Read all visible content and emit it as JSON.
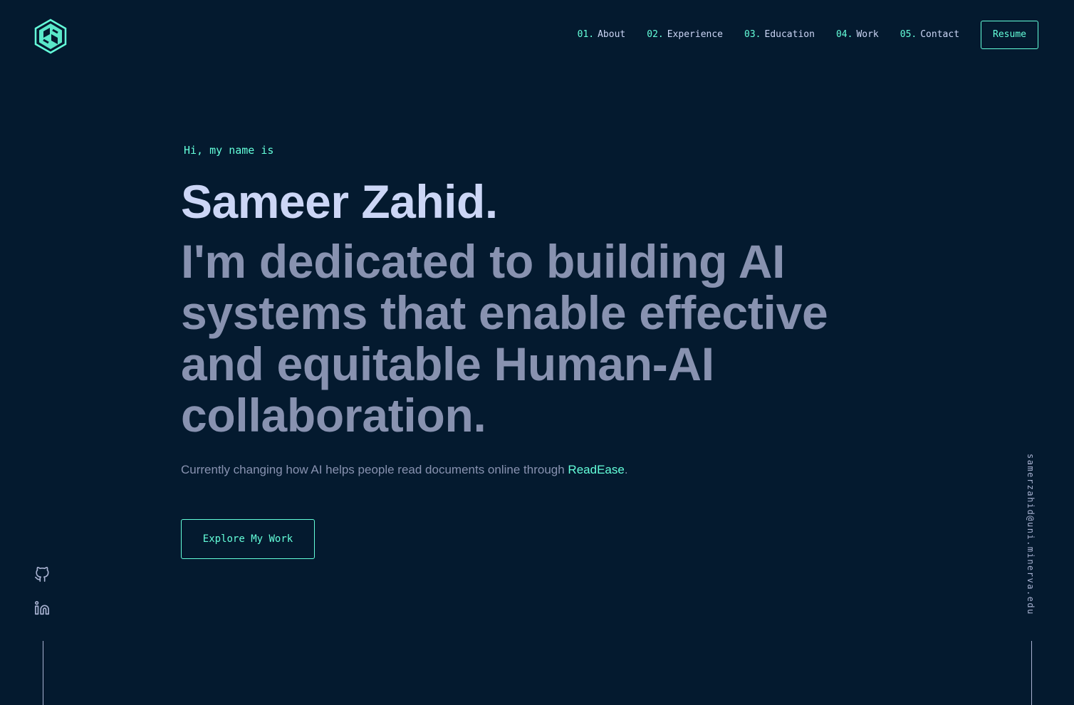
{
  "header": {
    "logo_icon": "hexagon-sz-logo-icon",
    "nav": [
      {
        "num": "01.",
        "label": "About"
      },
      {
        "num": "02.",
        "label": "Experience"
      },
      {
        "num": "03.",
        "label": "Education"
      },
      {
        "num": "04.",
        "label": "Work"
      },
      {
        "num": "05.",
        "label": "Contact"
      }
    ],
    "resume_label": "Resume"
  },
  "hero": {
    "greeting": "Hi, my name is",
    "name": "Sameer Zahid.",
    "tagline": "I'm dedicated to building AI systems that enable effective and equitable Human-AI collaboration.",
    "current_prefix": "Currently changing how AI helps people read documents online through ",
    "current_link": "ReadEase",
    "current_suffix": ".",
    "cta_label": "Explore My Work"
  },
  "side": {
    "social_icons": [
      "github-icon",
      "linkedin-icon"
    ],
    "email": "samerzahid@uni.minerva.edu"
  },
  "colors": {
    "background": "#041a2f",
    "accent": "#64ffda",
    "heading": "#ccd6f6",
    "text": "#8892b0"
  }
}
